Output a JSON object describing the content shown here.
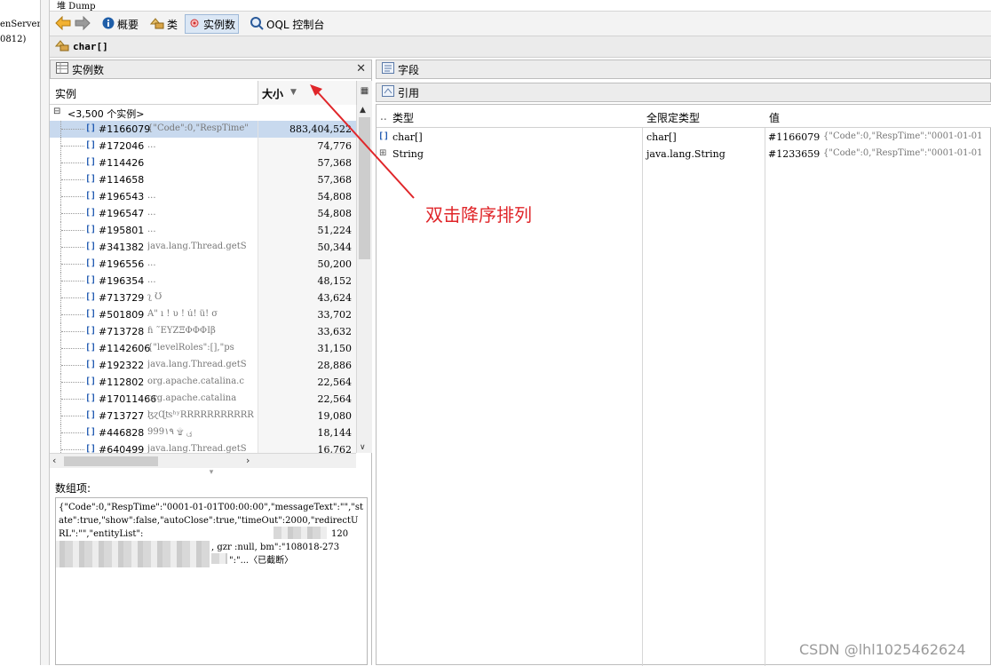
{
  "left_strip": {
    "line1": "enServer",
    "line2": "0812)"
  },
  "tab": {
    "title": "堆 Dump"
  },
  "toolbar": {
    "summary_label": "概要",
    "classes_label": "类",
    "instances_label": "实例数",
    "oql_label": "OQL 控制台"
  },
  "class_header": {
    "title": "char[]"
  },
  "instances_panel": {
    "title": "实例数",
    "col_instance": "实例",
    "col_size": "大小",
    "root_label": "<3,500 个实例>",
    "rows": [
      {
        "id": "#1166079",
        "preview": "{\"Code\":0,\"RespTime\"",
        "size": "883,404,522"
      },
      {
        "id": "#172046",
        "preview": "...",
        "size": "74,776"
      },
      {
        "id": "#114426",
        "preview": "",
        "size": "57,368"
      },
      {
        "id": "#114658",
        "preview": "",
        "size": "57,368"
      },
      {
        "id": "#196543",
        "preview": "...",
        "size": "54,808"
      },
      {
        "id": "#196547",
        "preview": "...",
        "size": "54,808"
      },
      {
        "id": "#195801",
        "preview": "...",
        "size": "51,224"
      },
      {
        "id": "#341382",
        "preview": "java.lang.Thread.getS",
        "size": "50,344"
      },
      {
        "id": "#196556",
        "preview": "...",
        "size": "50,200"
      },
      {
        "id": "#196354",
        "preview": "...",
        "size": "48,152"
      },
      {
        "id": "#713729",
        "preview": "ʅ                 Ʊ",
        "size": "43,624"
      },
      {
        "id": "#501809",
        "preview": "Ā\"  ı ! υ ! ú! ü! σ",
        "size": "33,702"
      },
      {
        "id": "#713728",
        "preview": "ɦ      ˜EYZΞΦΦΦĪβ",
        "size": "33,632"
      },
      {
        "id": "#1142606",
        "preview": "{\"levelRoles\":[],\"ps",
        "size": "31,150"
      },
      {
        "id": "#192322",
        "preview": "java.lang.Thread.getS",
        "size": "28,886"
      },
      {
        "id": "#112802",
        "preview": "org.apache.catalina.c",
        "size": "22,564"
      },
      {
        "id": "#17011466",
        "preview": "org.apache.catalina",
        "size": "22,564"
      },
      {
        "id": "#713727",
        "preview": "ɮɀɊʦʰʸRRRRRRRRRRR",
        "size": "19,080"
      },
      {
        "id": "#446828",
        "preview": "999ي  ۩      ١٩",
        "size": "18,144"
      },
      {
        "id": "#640499",
        "preview": "java.lang.Thread.getS",
        "size": "16,762"
      }
    ]
  },
  "array_items": {
    "label": "数组项:",
    "text": "{\"Code\":0,\"RespTime\":\"0001-01-01T00:00:00\",\"messageText\":\"\",\"state\":true,\"show\":false,\"autoClose\":true,\"timeOut\":2000,\"redirectURL\":\"\",\"entityList\":",
    "text_tail_1": "120",
    "text_tail_2": ", gzr :null, bm\":\"108018-273",
    "text_tail_3": "\":\"...〈已截断〉"
  },
  "fields_panel": {
    "title": "字段"
  },
  "refs_panel": {
    "title": "引用",
    "col_type": "类型",
    "col_fq_type": "全限定类型",
    "col_value": "值",
    "rows": [
      {
        "type": "char[]",
        "fq_type": "char[]",
        "id": "#1166079",
        "value": "{\"Code\":0,\"RespTime\":\"0001-01-01"
      },
      {
        "type": "String",
        "fq_type": "java.lang.String",
        "id": "#1233659",
        "value": "{\"Code\":0,\"RespTime\":\"0001-01-01"
      }
    ]
  },
  "annotation": {
    "text": "双击降序排列"
  },
  "watermark": {
    "text": "CSDN @lhl1025462624"
  },
  "colors": {
    "accent": "#e0262a",
    "selection": "#c8d9ee",
    "toolbar_active": "#dbe7f5"
  }
}
